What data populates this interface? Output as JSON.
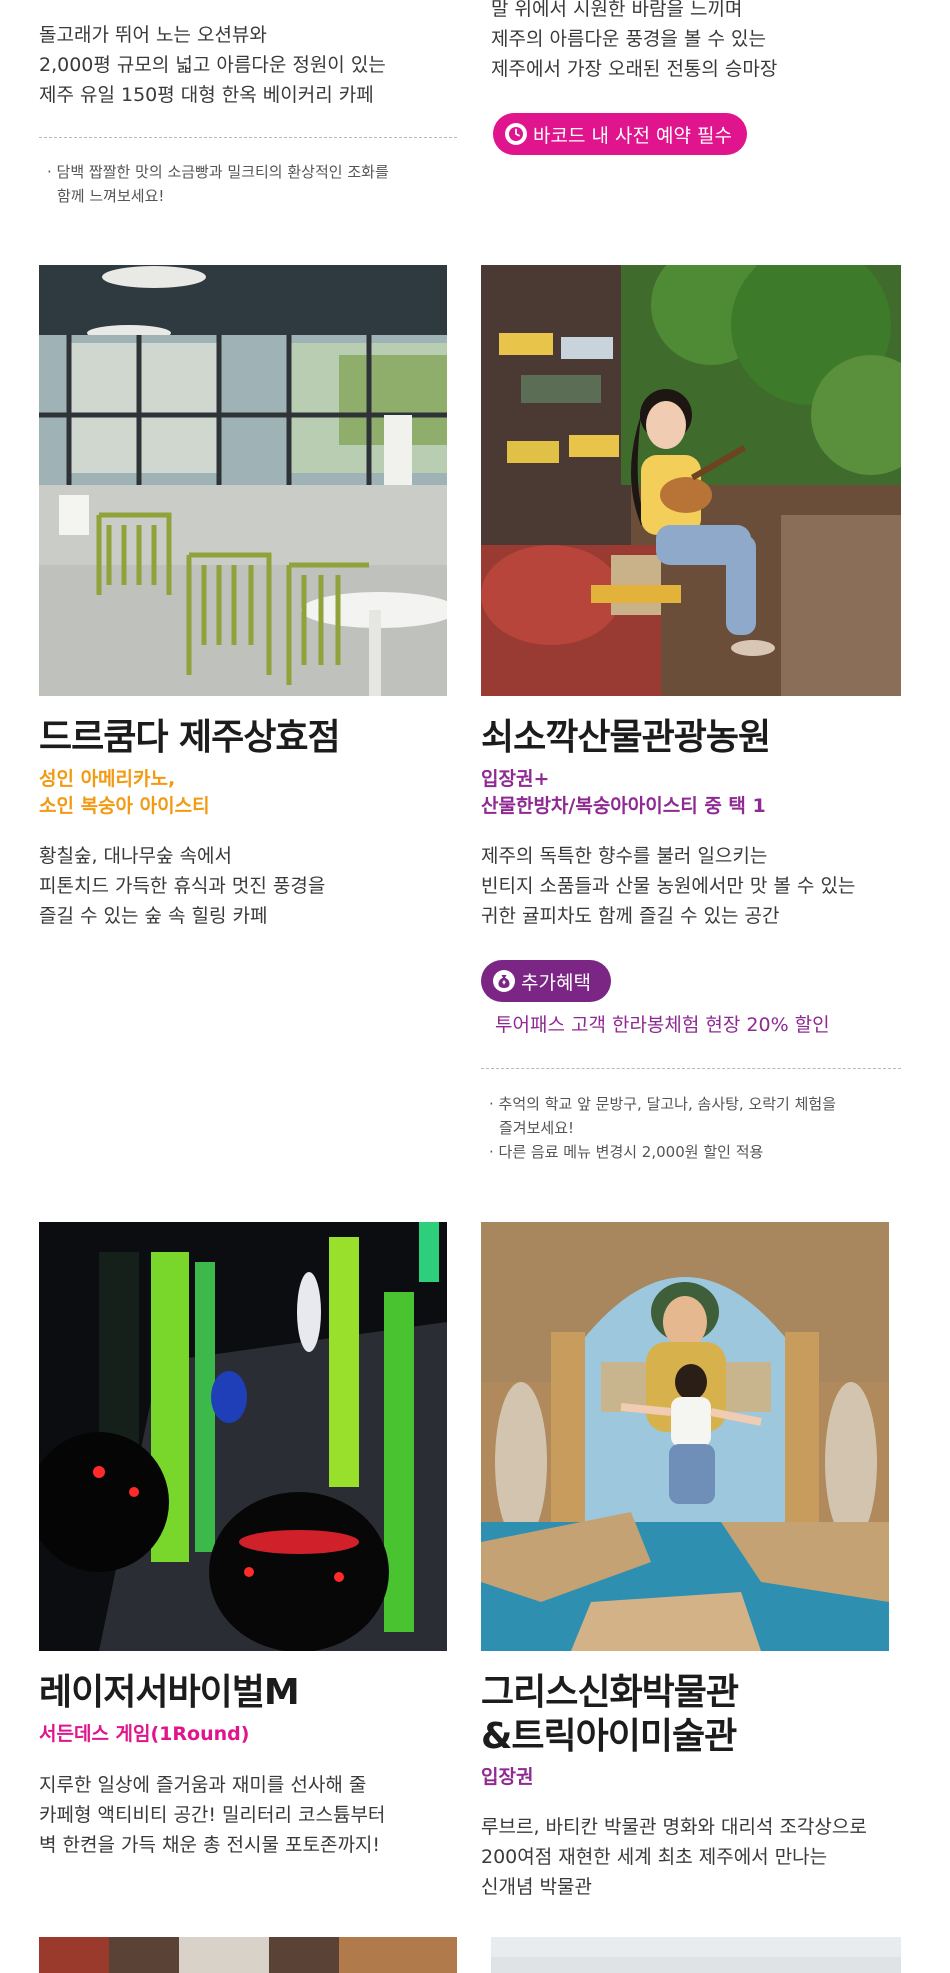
{
  "colors": {
    "orange": "#f29a12",
    "purple": "#8e2a92",
    "magenta": "#e0148c",
    "badge_purple": "#7b2584",
    "dash": "#b9b9b9"
  },
  "top_left": {
    "desc": [
      "돌고래가 뛰어 노는 오션뷰와",
      "2,000평 규모의 넓고 아름다운 정원이 있는",
      "제주 유일 150평 대형 한옥 베이커리 카페"
    ],
    "notes": [
      "· 담백 짭짤한 맛의 소금빵과 밀크티의 환상적인 조화를",
      "함께 느껴보세요!"
    ]
  },
  "top_right": {
    "desc": [
      "말 위에서 시원한 바람을 느끼며",
      "제주의 아름다운 풍경을 볼 수 있는",
      "제주에서 가장 오래된 전통의 승마장"
    ],
    "badge": {
      "icon": "clock-icon",
      "label": "바코드 내 사전 예약 필수"
    }
  },
  "cards": [
    {
      "image": "cafe-interior-photo",
      "title": "드르쿰다 제주상효점",
      "benefit": [
        "성인 아메리카노,",
        "소인 복숭아 아이스티"
      ],
      "benefit_color": "orange",
      "desc": [
        "황칠숲, 대나무숲 속에서",
        "피톤치드 가득한 휴식과 멋진 풍경을",
        "즐길 수 있는 숲 속 힐링 카페"
      ]
    },
    {
      "image": "farm-ukulele-photo",
      "title": "쇠소깍산물관광농원",
      "benefit": [
        "입장권+",
        "산물한방차/복숭아아이스티 중 택 1"
      ],
      "benefit_color": "purple",
      "desc": [
        "제주의 독특한 향수를 불러 일으키는",
        "빈티지 소품들과 산물 농원에서만 맛 볼 수 있는",
        "귀한 귤피차도 함께 즐길 수 있는 공간"
      ],
      "extra": {
        "icon": "money-bag-icon",
        "label": "추가혜택",
        "text": "투어패스 고객 한라봉체험 현장 20% 할인"
      },
      "notes": [
        "· 추억의 학교 앞 문방구, 달고나, 솜사탕, 오락기 체험을",
        "즐겨보세요!",
        "· 다른 음료 메뉴 변경시 2,000원 할인 적용"
      ]
    },
    {
      "image": "laser-arena-photo",
      "title": "레이저서바이벌M",
      "benefit": [
        "서든데스 게임(1Round)"
      ],
      "benefit_color": "magenta",
      "desc": [
        "지루한 일상에 즐거움과 재미를 선사해 줄",
        "카페형 액티비티 공간! 밀리터리 코스튬부터",
        "벽 한켠을 가득 채운 총 전시물 포토존까지!"
      ]
    },
    {
      "image": "trick-art-photo",
      "title": [
        "그리스신화박물관",
        "&트릭아이미술관"
      ],
      "benefit": [
        "입장권"
      ],
      "benefit_color": "purple",
      "desc": [
        "루브르, 바티칸 박물관 명화와 대리석 조각상으로",
        "200여점 재현한 세계 최초 제주에서 만나는",
        "신개념 박물관"
      ]
    }
  ]
}
